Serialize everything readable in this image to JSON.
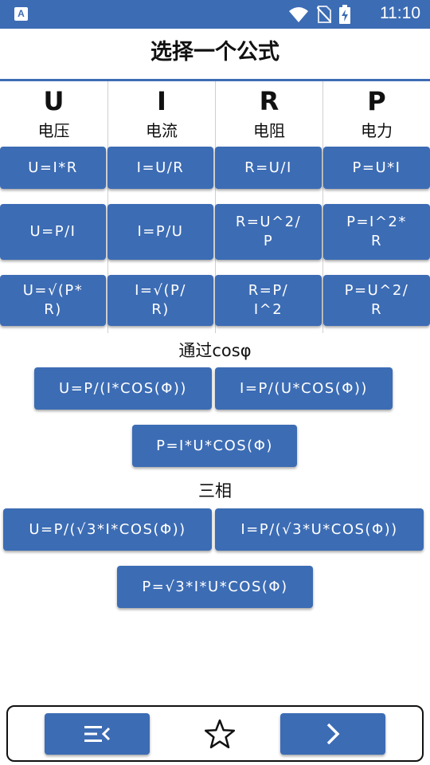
{
  "status": {
    "app_icon": "A",
    "time": "11:10"
  },
  "header": {
    "title": "选择一个公式"
  },
  "columns": [
    {
      "letter": "U",
      "name": "电压",
      "formulas": [
        "U=I*R",
        "U=P/I",
        "U=√(P*\nR)"
      ]
    },
    {
      "letter": "I",
      "name": "电流",
      "formulas": [
        "I=U/R",
        "I=P/U",
        "I=√(P/\nR)"
      ]
    },
    {
      "letter": "R",
      "name": "电阻",
      "formulas": [
        "R=U/I",
        "R=U^2/\nP",
        "R=P/\nI^2"
      ]
    },
    {
      "letter": "P",
      "name": "电力",
      "formulas": [
        "P=U*I",
        "P=I^2*\nR",
        "P=U^2/\nR"
      ]
    }
  ],
  "cos_section": {
    "title": "通过cosφ",
    "formulas": [
      "U=P/(I*COS(Φ))",
      "I=P/(U*COS(Φ))",
      "P=I*U*COS(Φ)"
    ]
  },
  "three_phase": {
    "title": "三相",
    "formulas": [
      "U=P/(√3*I*COS(Φ))",
      "I=P/(√3*U*COS(Φ))",
      "P=√3*I*U*COS(Φ)"
    ]
  },
  "bottom_nav": {
    "left_icon": "menu-collapse-icon",
    "center_icon": "star-outline-icon",
    "right_icon": "chevron-right-icon"
  },
  "colors": {
    "accent": "#3c6cb4",
    "text": "#111111"
  }
}
